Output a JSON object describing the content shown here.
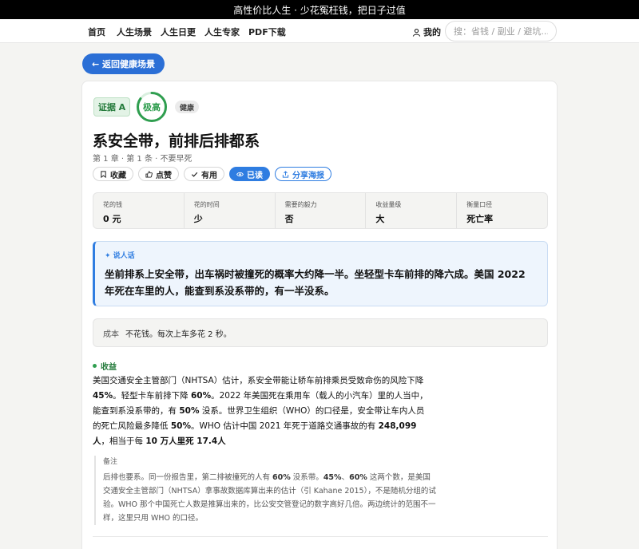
{
  "topbar": {
    "text": "高性价比人生 · 少花冤枉钱，把日子过值"
  },
  "nav": {
    "items": [
      "首页",
      "人生场景",
      "人生日更",
      "人生专家",
      "PDF下载"
    ],
    "profile": "我的",
    "search_placeholder": "搜：省钱 / 副业 / 避坑..."
  },
  "back_button": "← 返回健康场景",
  "card": {
    "evidence_badge": "证据 A",
    "rating": "极高",
    "rating_level": 0.85,
    "tag": "健康",
    "title": "系安全带，前排后排都系",
    "subtitle": "第 1 章 · 第 1 条 · 不要早死",
    "actions": {
      "collect": "收藏",
      "like": "点赞",
      "useful": "有用",
      "read": "已读",
      "share": "分享海报"
    },
    "stats": [
      {
        "label": "花的钱",
        "value": "0 元"
      },
      {
        "label": "花的时间",
        "value": "少"
      },
      {
        "label": "需要的毅力",
        "value": "否"
      },
      {
        "label": "收益量级",
        "value": "大"
      },
      {
        "label": "衡量口径",
        "value": "死亡率"
      }
    ],
    "plain": {
      "heading": "✦ 说人话",
      "text": "坐前排系上安全带，出车祸时被撞死的概率大约降一半。坐轻型卡车前排的降六成。美国 2022 年死在车里的人，能查到系没系带的，有一半没系。"
    },
    "cost": {
      "label": "成本",
      "text": "不花钱。每次上车多花 2 秒。"
    },
    "benefit": {
      "heading": "收益",
      "t1": "美国交通安全主管部门（NHTSA）估计，系安全带能让轿车前排乘员受致命伤的风险下降 ",
      "b1": "45%",
      "t2": "。轻型卡车前排下降 ",
      "b2": "60%",
      "t3": "。2022 年美国死在乘用车（载人的小汽车）里的人当中，能查到系没系带的，有 ",
      "b3": "50%",
      "t4": " 没系。世界卫生组织（WHO）的口径是，安全带让车内人员的死亡风险最多降低 ",
      "b4": "50%",
      "t5": "。WHO 估计中国 2021 年死于道路交通事故的有 ",
      "b5": "248,099人",
      "t6": "，相当于每 ",
      "b6": "10 万人里死 17.4人"
    },
    "note": {
      "label": "备注",
      "t1": "后排也要系。同一份报告里，第二排被撞死的人有 ",
      "b1": "60%",
      "t2": " 没系带。",
      "b2": "45%",
      "t3": "、",
      "b3": "60%",
      "t4": " 这两个数，是美国交通安全主管部门（NHTSA）拿事故数据库算出来的估计（引 Kahane 2015），不是随机分组的试验。WHO 那个中国死亡人数是推算出来的，比公安交管登记的数字高好几倍。两边统计的范围不一样，这里只用 WHO 的口径。"
    }
  },
  "colors": {
    "accent": "#2f7de1",
    "green": "#2f9e4f"
  }
}
